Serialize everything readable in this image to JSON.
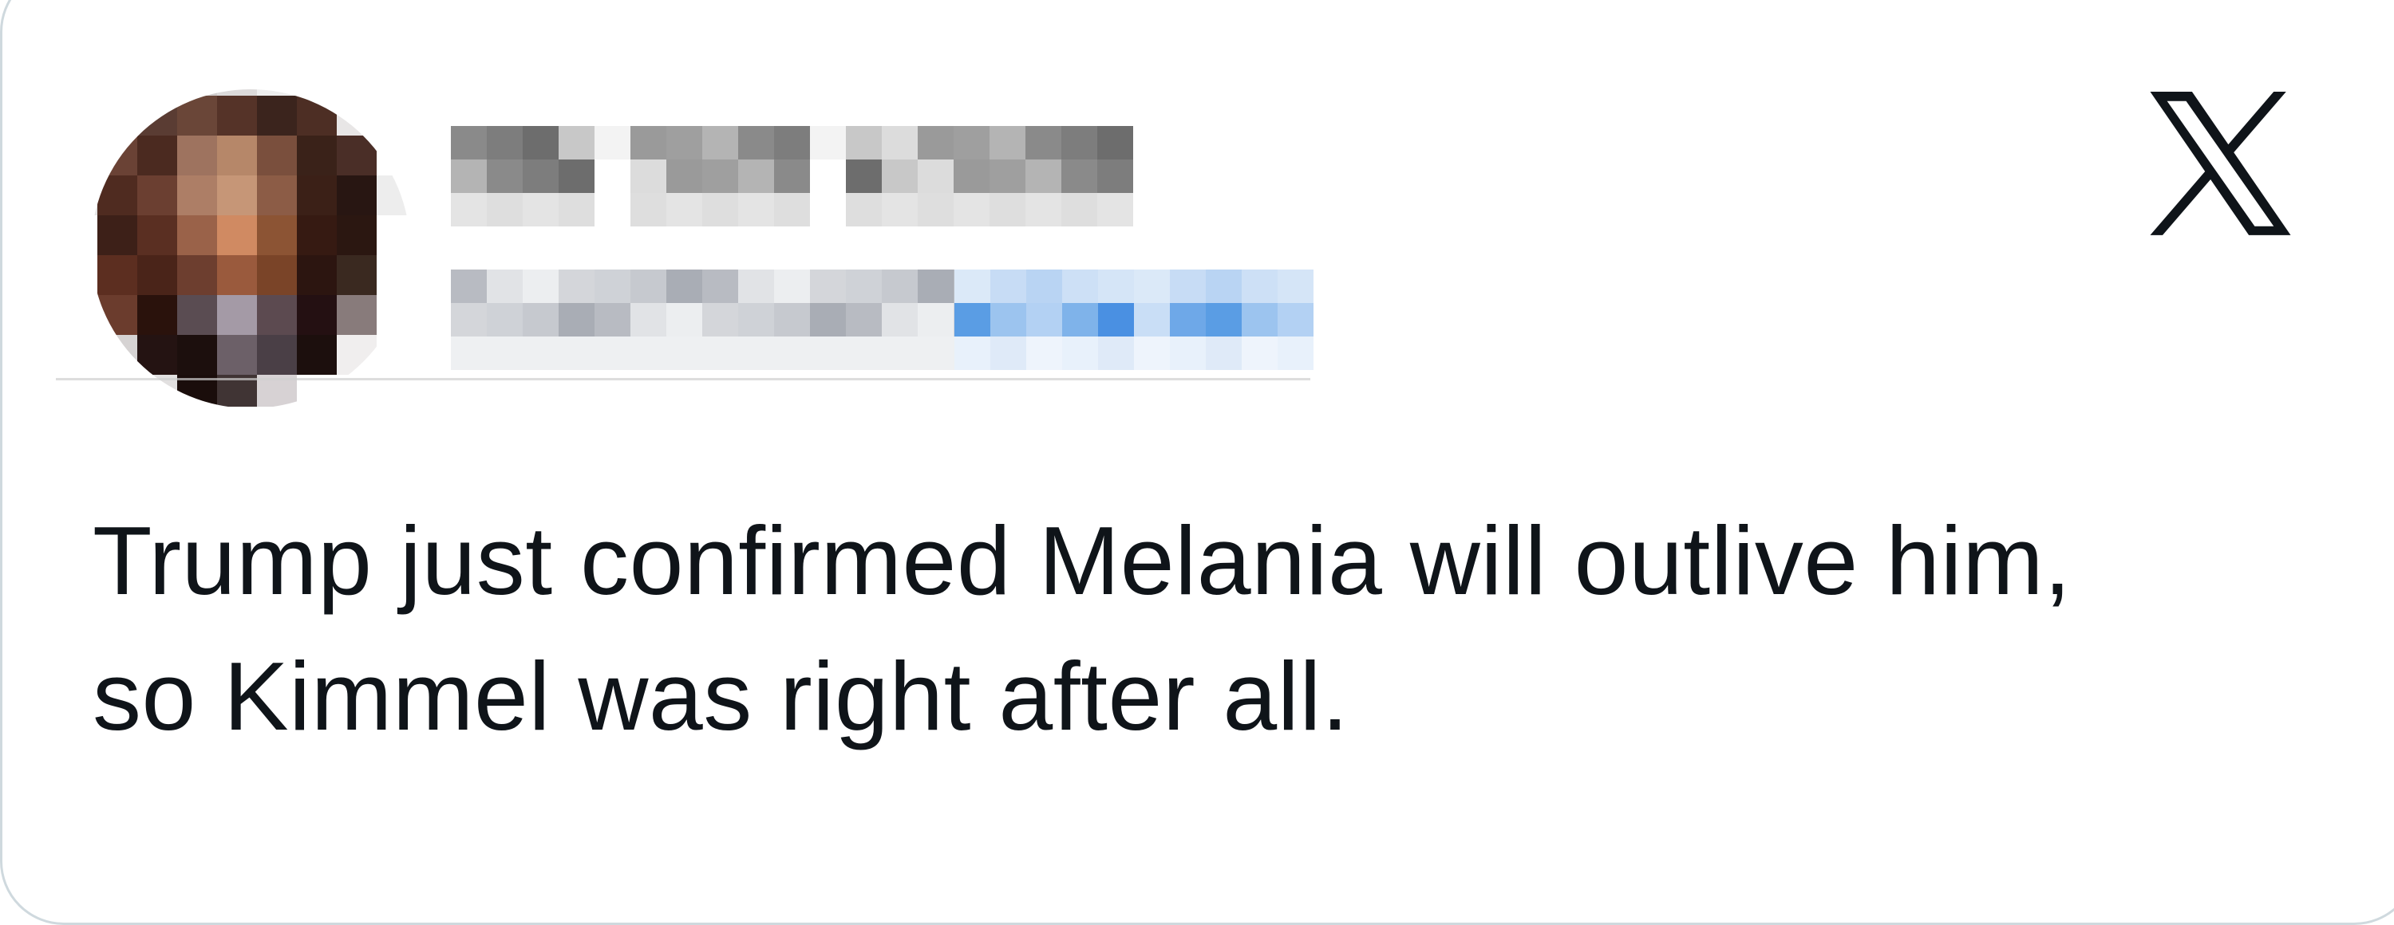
{
  "post": {
    "network_icon": "x-logo-icon",
    "author": {
      "display_name": "",
      "handle": "",
      "follow_label": "",
      "avatar": "pixelated-avatar"
    },
    "text": "Trump just confirmed Melania will outlive him,\nso Kimmel was right after all."
  },
  "colors": {
    "text": "#0f1419",
    "border": "#cfd9de",
    "follow_blue": "#4a90e2",
    "background": "#ffffff"
  }
}
